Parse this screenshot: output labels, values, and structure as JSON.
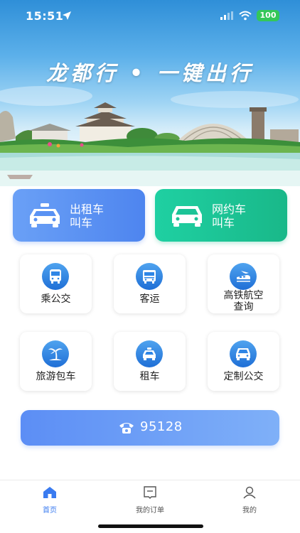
{
  "status_bar": {
    "time": "15:51",
    "battery": "100"
  },
  "hero": {
    "slogan": "龙都行 • 一键出行"
  },
  "call_buttons": {
    "taxi": {
      "line1": "出租车",
      "line2": "叫车"
    },
    "ride_hailing": {
      "line1": "网约车",
      "line2": "叫车"
    }
  },
  "services": {
    "bus": "乘公交",
    "coach": "客运",
    "rail_air_line1": "高铁航空",
    "rail_air_line2": "查询",
    "tour_charter": "旅游包车",
    "car_rental": "租车",
    "custom_bus": "定制公交"
  },
  "hotline": {
    "number": "95128"
  },
  "tabbar": {
    "home": "首页",
    "orders": "我的订单",
    "mine": "我的"
  },
  "colors": {
    "accent_blue": "#3a7bf0",
    "taxi_button": "#5a92f3",
    "ride_button": "#1cc497",
    "icon_circle": "#2f86e6"
  },
  "icons": [
    "location-arrow-icon",
    "signal-icon",
    "wifi-icon",
    "taxi-icon",
    "car-icon",
    "bus-icon",
    "coach-icon",
    "train-plane-icon",
    "palm-tree-icon",
    "rental-car-icon",
    "custom-bus-icon",
    "phone-icon",
    "home-icon",
    "orders-icon",
    "user-icon"
  ]
}
